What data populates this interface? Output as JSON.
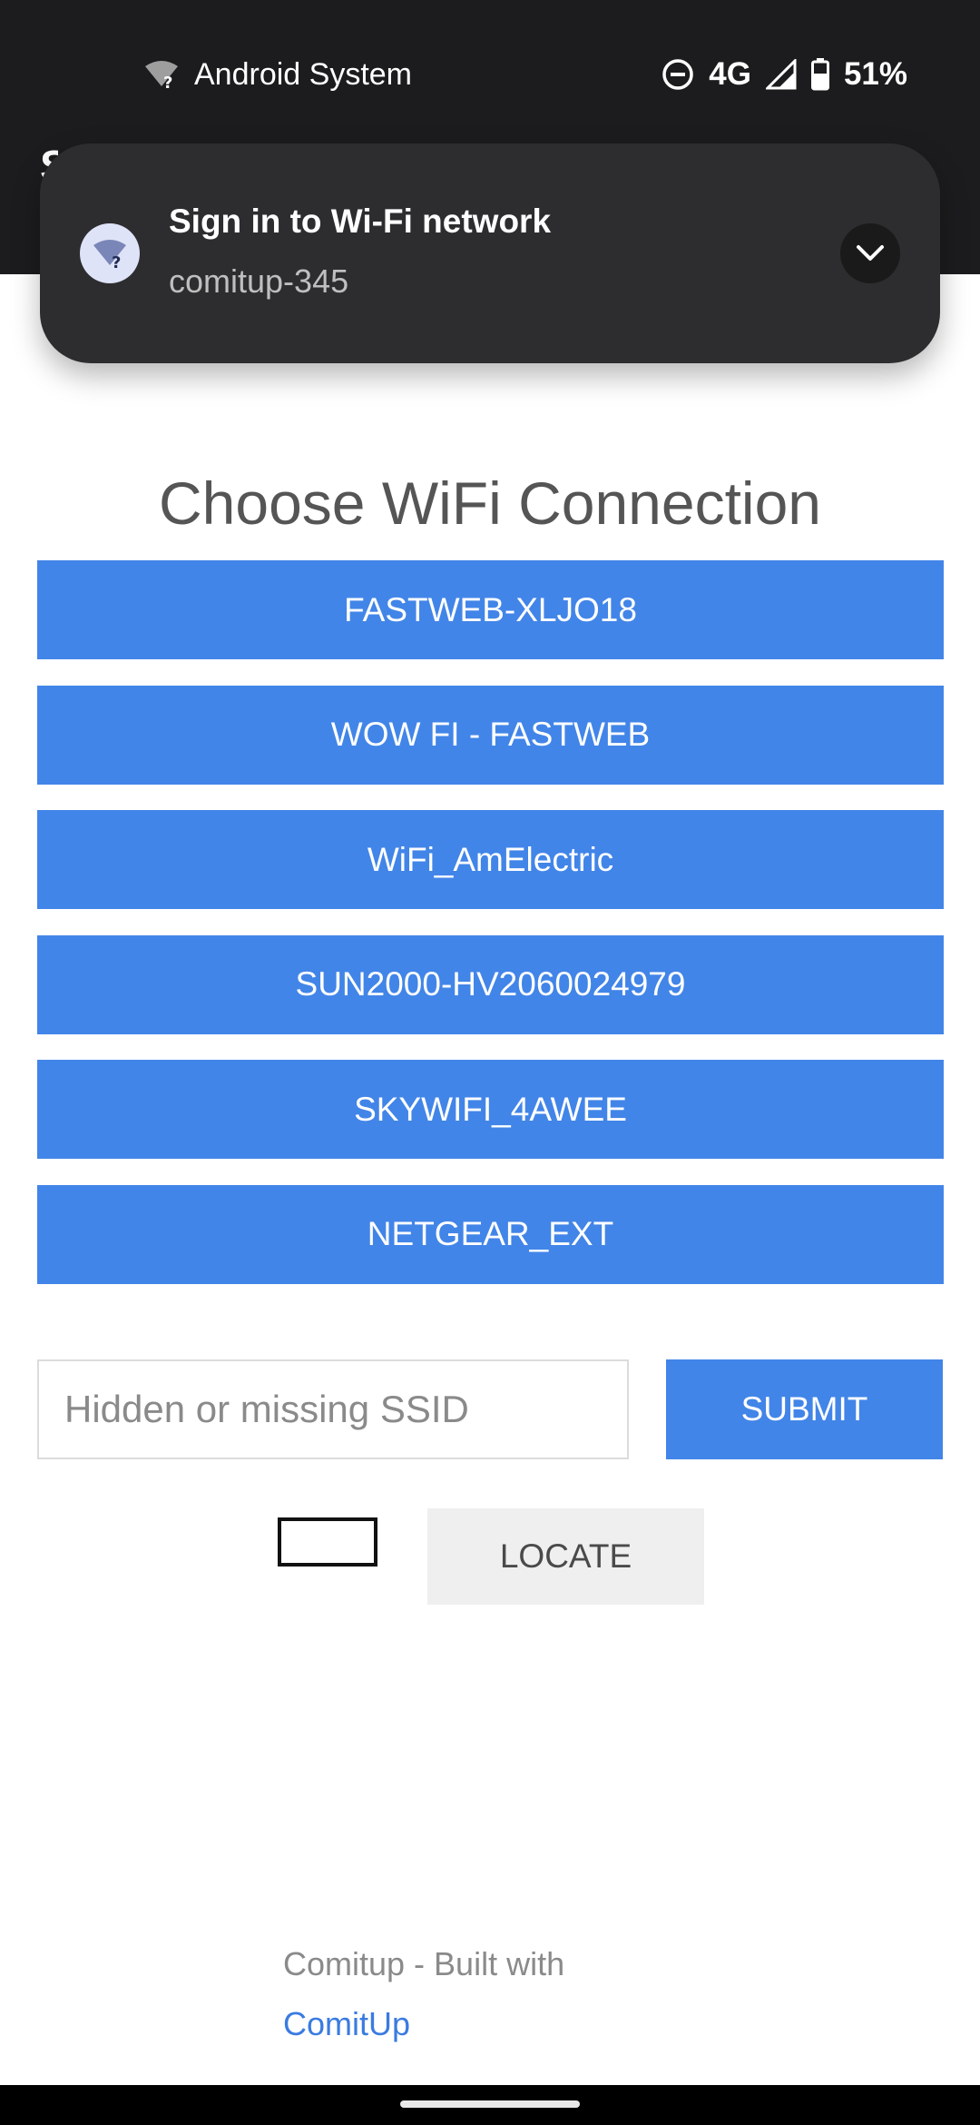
{
  "status_bar": {
    "notification_source": "Android System",
    "network": "4G",
    "battery": "51%",
    "icons": [
      "wifi-question-icon",
      "do-not-disturb-icon",
      "signal-icon",
      "battery-icon"
    ]
  },
  "app_header": {
    "title_partial": "S"
  },
  "notification": {
    "title": "Sign in to Wi-Fi network",
    "subtitle": "comitup-345",
    "icon": "wifi-question-icon",
    "expand_icon": "chevron-down-icon"
  },
  "page": {
    "title": "Choose WiFi Connection",
    "networks": [
      "FASTWEB-XLJO18",
      "WOW FI - FASTWEB",
      "WiFi_AmElectric",
      "SUN2000-HV2060024979",
      "SKYWIFI_4AWEE",
      "NETGEAR_EXT"
    ],
    "ssid_input": {
      "placeholder": "Hidden or missing SSID",
      "value": ""
    },
    "submit_label": "SUBMIT",
    "locate_label": "LOCATE"
  },
  "footer": {
    "text": "Comitup - Built with",
    "link": "ComitUp"
  },
  "colors": {
    "accent": "#4285e8",
    "topbar": "#1c1c1e",
    "notification_bg": "#2d2d30",
    "locate_bg": "#efefef"
  }
}
